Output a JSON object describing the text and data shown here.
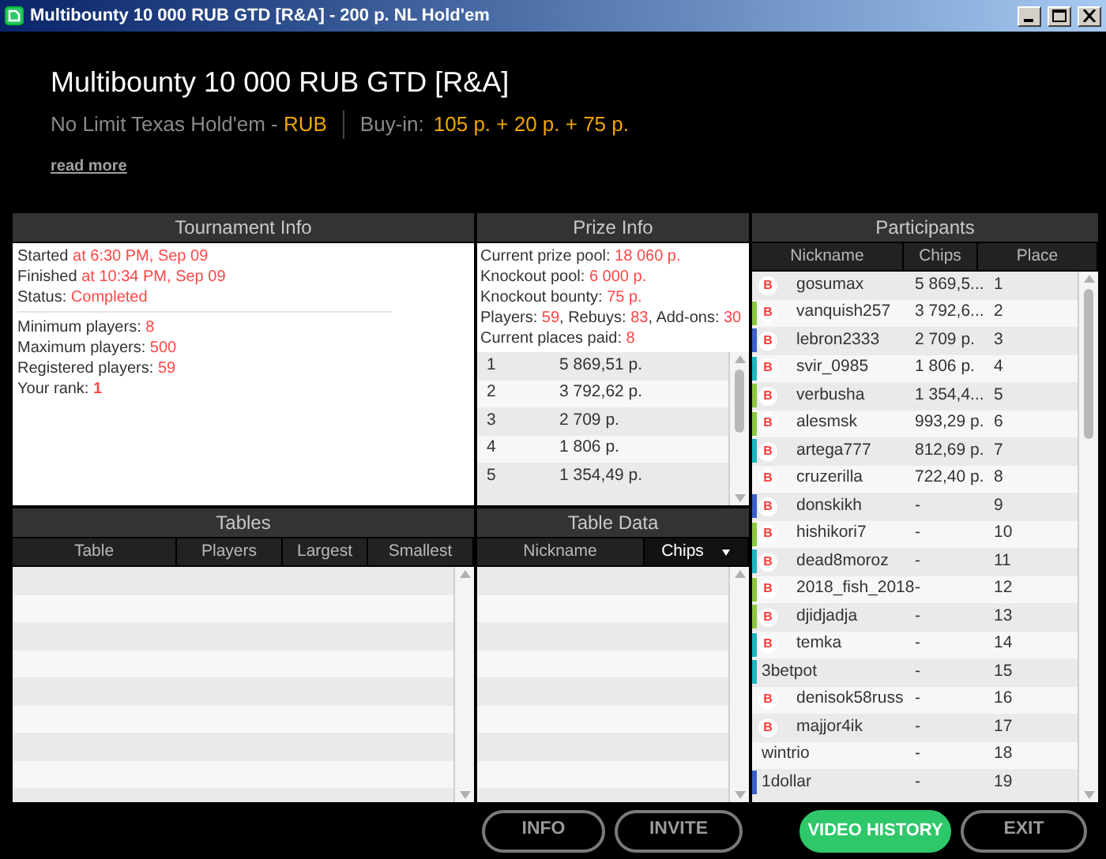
{
  "window": {
    "title": "Multibounty 10 000 RUB GTD [R&A] - 200 р. NL Hold'em"
  },
  "header": {
    "title": "Multibounty 10 000 RUB GTD [R&A]",
    "game": "No Limit Texas Hold'em - ",
    "currency": "RUB",
    "buyin_label": "Buy-in:",
    "buyin": "105 р. + 20 р. + 75 р.",
    "link": "read more"
  },
  "tournament_info": {
    "title": "Tournament Info",
    "groups": [
      [
        {
          "label": "Started",
          "value": "at 6:30 PM, Sep 09"
        },
        {
          "label": "Finished",
          "value": "at 10:34 PM, Sep 09"
        },
        {
          "label": "Status:",
          "value": "Completed"
        }
      ],
      [
        {
          "label": "Minimum players:",
          "value": "8"
        },
        {
          "label": "Maximum players:",
          "value": "500"
        },
        {
          "label": "Registered players:",
          "value": "59"
        },
        {
          "label": "Your rank:",
          "value": "1",
          "bold": true
        }
      ]
    ]
  },
  "prize_info": {
    "title": "Prize Info",
    "lines": [
      [
        {
          "label": "Current prize pool:",
          "value": "18 060 р."
        }
      ],
      [
        {
          "label": "Knockout pool:",
          "value": "6 000 р."
        }
      ],
      [
        {
          "label": "Knockout bounty:",
          "value": "75 р."
        }
      ],
      [
        {
          "label": "Players:",
          "value": "59"
        },
        {
          "label": ", Rebuys:",
          "value": "83"
        },
        {
          "label": ", Add-ons:",
          "value": "30"
        }
      ],
      [
        {
          "label": "Current places paid:",
          "value": "8"
        }
      ]
    ],
    "places": [
      {
        "place": "1",
        "prize": "5 869,51 р."
      },
      {
        "place": "2",
        "prize": "3 792,62 р."
      },
      {
        "place": "3",
        "prize": "2 709 р."
      },
      {
        "place": "4",
        "prize": "1 806 р."
      },
      {
        "place": "5",
        "prize": "1 354,49 р."
      }
    ]
  },
  "participants": {
    "title": "Participants",
    "columns": [
      "Nickname",
      "Chips",
      "Place"
    ],
    "rows": [
      {
        "badge": "B",
        "nickname": "gosumax",
        "chips": "5 869,5...",
        "place": "1"
      },
      {
        "badge": "B",
        "color": "#8cc63f",
        "nickname": "vanquish257",
        "chips": "3 792,6...",
        "place": "2"
      },
      {
        "badge": "B",
        "color": "#3b5fc8",
        "nickname": "lebron2333",
        "chips": "2 709 р.",
        "place": "3"
      },
      {
        "badge": "B",
        "color": "#1fb5c0",
        "nickname": "svir_0985",
        "chips": "1 806 р.",
        "place": "4"
      },
      {
        "badge": "B",
        "color": "#8cc63f",
        "nickname": "verbusha",
        "chips": "1 354,4...",
        "place": "5"
      },
      {
        "badge": "B",
        "color": "#8cc63f",
        "nickname": "alesmsk",
        "chips": "993,29 р.",
        "place": "6"
      },
      {
        "badge": "B",
        "color": "#1fb5c0",
        "nickname": "artega777",
        "chips": "812,69 р.",
        "place": "7"
      },
      {
        "badge": "B",
        "nickname": "cruzerilla",
        "chips": "722,40 р.",
        "place": "8"
      },
      {
        "badge": "B",
        "color": "#3b5fc8",
        "nickname": "donskikh",
        "chips": "-",
        "place": "9"
      },
      {
        "badge": "B",
        "color": "#8cc63f",
        "nickname": "hishikori7",
        "chips": "-",
        "place": "10"
      },
      {
        "badge": "B",
        "color": "#1fb5c0",
        "nickname": "dead8moroz",
        "chips": "-",
        "place": "11"
      },
      {
        "badge": "B",
        "color": "#8cc63f",
        "nickname": "2018_fish_2018",
        "chips": "-",
        "place": "12"
      },
      {
        "badge": "B",
        "color": "#8cc63f",
        "nickname": "djidjadja",
        "chips": "-",
        "place": "13"
      },
      {
        "badge": "B",
        "color": "#1fb5c0",
        "nickname": "temka",
        "chips": "-",
        "place": "14"
      },
      {
        "color": "#1fb5c0",
        "nickname": "3betpot",
        "chips": "-",
        "place": "15"
      },
      {
        "badge": "B",
        "nickname": "denisok58russ",
        "chips": "-",
        "place": "16"
      },
      {
        "badge": "B",
        "nickname": "majjor4ik",
        "chips": "-",
        "place": "17"
      },
      {
        "nickname": "wintrio",
        "chips": "-",
        "place": "18"
      },
      {
        "color": "#3b5fc8",
        "nickname": "1dollar",
        "chips": "-",
        "place": "19"
      }
    ]
  },
  "tables": {
    "title": "Tables",
    "columns": [
      "Table",
      "Players",
      "Largest",
      "Smallest"
    ]
  },
  "table_data": {
    "title": "Table Data",
    "columns": [
      {
        "label": "Nickname",
        "sorted": false
      },
      {
        "label": "Chips",
        "sorted": true
      }
    ]
  },
  "buttons": [
    {
      "label": "INFO",
      "kind": "outline"
    },
    {
      "label": "INVITE",
      "kind": "outline"
    },
    {
      "label": "VIDEO HISTORY",
      "kind": "primary"
    },
    {
      "label": "EXIT",
      "kind": "outline"
    }
  ]
}
